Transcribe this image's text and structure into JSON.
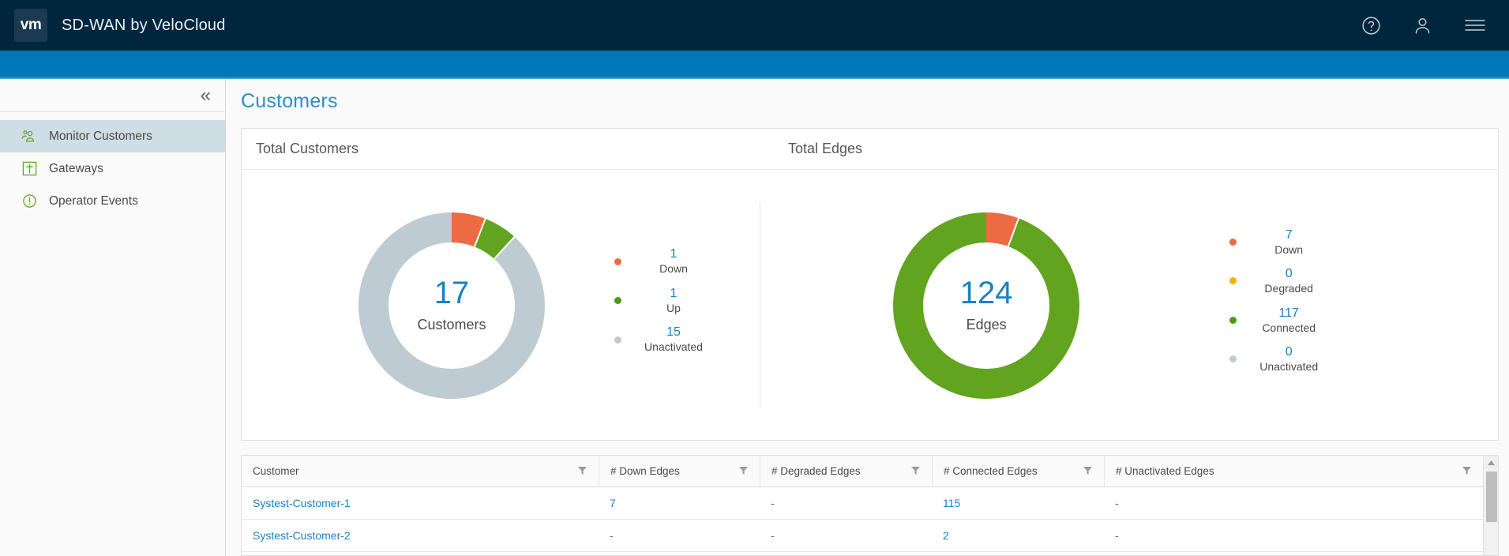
{
  "header": {
    "logo_text": "vm",
    "title": "SD-WAN by VeloCloud",
    "icons": [
      "help-icon",
      "user-icon",
      "menu-icon"
    ],
    "bg_color": "#00263E",
    "accent_bar_color": "#0077B8"
  },
  "sidebar": {
    "collapse_label": "«",
    "items": [
      {
        "label": "Monitor Customers",
        "icon": "customers-icon",
        "active": true
      },
      {
        "label": "Gateways",
        "icon": "gateway-icon",
        "active": false
      },
      {
        "label": "Operator Events",
        "icon": "events-icon",
        "active": false
      }
    ]
  },
  "main": {
    "page_title": "Customers"
  },
  "cards": {
    "customers_header": "Total Customers",
    "edges_header": "Total Edges"
  },
  "chart_data": [
    {
      "type": "pie",
      "title": "Total Customers",
      "center_value": "17",
      "center_label": "Customers",
      "total": 17,
      "categories": [
        "Down",
        "Up",
        "Unactivated"
      ],
      "values": [
        1,
        1,
        15
      ],
      "colors": [
        "#EC6B42",
        "#62A420",
        "#BFCBD2"
      ],
      "legend_position": "right",
      "start_angle": 0
    },
    {
      "type": "pie",
      "title": "Total Edges",
      "center_value": "124",
      "center_label": "Edges",
      "total": 124,
      "categories": [
        "Down",
        "Degraded",
        "Connected",
        "Unactivated"
      ],
      "values": [
        7,
        0,
        117,
        0
      ],
      "colors": [
        "#EC6B42",
        "#F0B10C",
        "#62A420",
        "#BFCBD2"
      ],
      "legend_position": "right",
      "start_angle": 0
    }
  ],
  "customers_legend": [
    {
      "value": "1",
      "label": "Down",
      "color": "#EC6B42"
    },
    {
      "value": "1",
      "label": "Up",
      "color": "#4A9C18"
    },
    {
      "value": "15",
      "label": "Unactivated",
      "color": "#BFCBD2"
    }
  ],
  "edges_legend": [
    {
      "value": "7",
      "label": "Down",
      "color": "#EC6B42"
    },
    {
      "value": "0",
      "label": "Degraded",
      "color": "#F0B10C"
    },
    {
      "value": "117",
      "label": "Connected",
      "color": "#4A9C18"
    },
    {
      "value": "0",
      "label": "Unactivated",
      "color": "#BFCBD2"
    }
  ],
  "table": {
    "columns": [
      "Customer",
      "# Down Edges",
      "# Degraded Edges",
      "# Connected Edges",
      "# Unactivated Edges"
    ],
    "rows": [
      {
        "customer": "Systest-Customer-1",
        "down": "7",
        "degraded": "-",
        "connected": "115",
        "unactivated": "-"
      },
      {
        "customer": "Systest-Customer-2",
        "down": "-",
        "degraded": "-",
        "connected": "2",
        "unactivated": "-"
      }
    ]
  }
}
